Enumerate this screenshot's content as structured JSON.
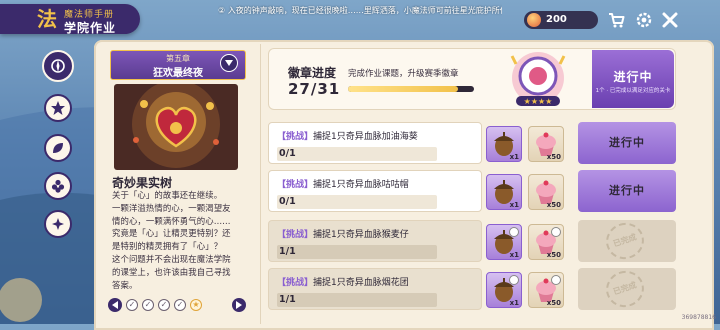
{
  "header": {
    "logo_glyph": "法",
    "subtitle": "魔法师手册",
    "title": "学院作业",
    "marquee": "② 入夜的钟声敲响，现在已经很晚啦……里辉洒落，小魔法师可前往星光庇护所休息哦~",
    "currency": "200"
  },
  "top_icons": [
    "coin-icon",
    "shop-cart-icon",
    "settings-gear-icon",
    "close-icon"
  ],
  "nav": [
    "homework-compass-icon",
    "badge-star-icon",
    "leaf-pattern-icon",
    "flower-pattern-icon",
    "star-pattern-icon"
  ],
  "chapter": {
    "number": "第五章",
    "title": "狂欢最终夜"
  },
  "story": {
    "title": "奇妙果实树",
    "lines": [
      "关于「心」的故事还在继续。",
      "一颗洋溢热情的心，一颗渴望友",
      "情的心，一颗满怀勇气的心……",
      "究竟是「心」让精灵更特别？还",
      "是特别的精灵拥有了「心」？",
      "这个问题并不会出现在魔法学院",
      "的课堂上，也许该由我自己寻找",
      "答案。"
    ]
  },
  "pager": {
    "dots": [
      "completed",
      "completed",
      "completed",
      "completed",
      "current"
    ]
  },
  "banner": {
    "label": "徽章进度",
    "count": "27/31",
    "progress": 0.87,
    "description": "完成作业课题，升级赛季徽章",
    "status": "进行中",
    "status_sub": "1个 · 已完成以满足对应的关卡"
  },
  "tasks": [
    {
      "tag": "【挑战】",
      "title": "捕捉1只奇异血脉加油海葵",
      "progress": "0/1",
      "status": "进行中",
      "done": false,
      "rewards": [
        {
          "icon": "acorn-reward-icon",
          "qty": "x1",
          "rarity": "purple"
        },
        {
          "icon": "cupcake-reward-icon",
          "qty": "x50",
          "rarity": "normal"
        }
      ]
    },
    {
      "tag": "【挑战】",
      "title": "捕捉1只奇异血脉咕咕帽",
      "progress": "0/1",
      "status": "进行中",
      "done": false,
      "rewards": [
        {
          "icon": "acorn-reward-icon",
          "qty": "x1",
          "rarity": "purple"
        },
        {
          "icon": "cupcake-reward-icon",
          "qty": "x50",
          "rarity": "normal"
        }
      ]
    },
    {
      "tag": "【挑战】",
      "title": "捕捉1只奇异血脉猴麦仔",
      "progress": "1/1",
      "status": "已完成",
      "done": true,
      "rewards": [
        {
          "icon": "acorn-reward-icon",
          "qty": "x1",
          "rarity": "purple"
        },
        {
          "icon": "cupcake-reward-icon",
          "qty": "x50",
          "rarity": "normal"
        }
      ]
    },
    {
      "tag": "【挑战】",
      "title": "捕捉1只奇异血脉烟花团",
      "progress": "1/1",
      "status": "已完成",
      "done": true,
      "rewards": [
        {
          "icon": "acorn-reward-icon",
          "qty": "x1",
          "rarity": "purple"
        },
        {
          "icon": "cupcake-reward-icon",
          "qty": "x50",
          "rarity": "normal"
        }
      ]
    }
  ],
  "version": "369878816",
  "colors": {
    "accent": "#3b2a6b",
    "status_purple": "#8c64cf",
    "gold": "#f2c14a",
    "panel": "#f7efe0"
  }
}
